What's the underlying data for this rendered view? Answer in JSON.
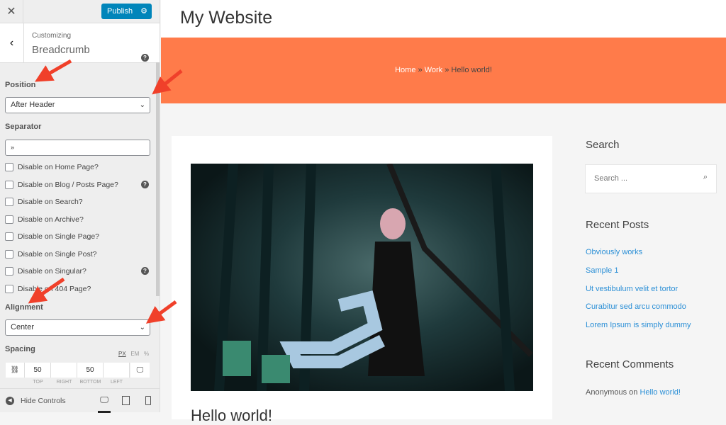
{
  "customizer": {
    "close": "✕",
    "publish": "Publish",
    "section_context": "Customizing",
    "section_title": "Breadcrumb",
    "position_label": "Position",
    "position_value": "After Header",
    "separator_label": "Separator",
    "separator_value": "»",
    "checkboxes": [
      "Disable on Home Page?",
      "Disable on Blog / Posts Page?",
      "Disable on Search?",
      "Disable on Archive?",
      "Disable on Single Page?",
      "Disable on Single Post?",
      "Disable on Singular?",
      "Disable on 404 Page?"
    ],
    "alignment_label": "Alignment",
    "alignment_value": "Center",
    "spacing_label": "Spacing",
    "units": [
      "PX",
      "EM",
      "%"
    ],
    "spacing_values": {
      "top": "50",
      "right": "",
      "bottom": "50",
      "left": ""
    },
    "spacing_labels": [
      "TOP",
      "RIGHT",
      "BOTTOM",
      "LEFT"
    ],
    "hide_controls": "Hide Controls"
  },
  "site": {
    "title": "My Website",
    "breadcrumb": {
      "home": "Home",
      "sep": "»",
      "work": "Work",
      "current": "Hello world!"
    },
    "post_title": "Hello world!",
    "sidebar": {
      "search_title": "Search",
      "search_placeholder": "Search ...",
      "recent_posts_title": "Recent Posts",
      "recent_posts": [
        "Obviously works",
        "Sample 1",
        "Ut vestibulum velit et tortor",
        "Curabitur sed arcu commodo",
        "Lorem Ipsum is simply dummy"
      ],
      "recent_comments_title": "Recent Comments",
      "comment_author": "Anonymous",
      "comment_on": "on",
      "comment_post": "Hello world!"
    }
  },
  "colors": {
    "accent": "#0085ba",
    "banner": "#ff7b4a",
    "link": "#2b8fd6",
    "arrow": "#f0402a"
  }
}
